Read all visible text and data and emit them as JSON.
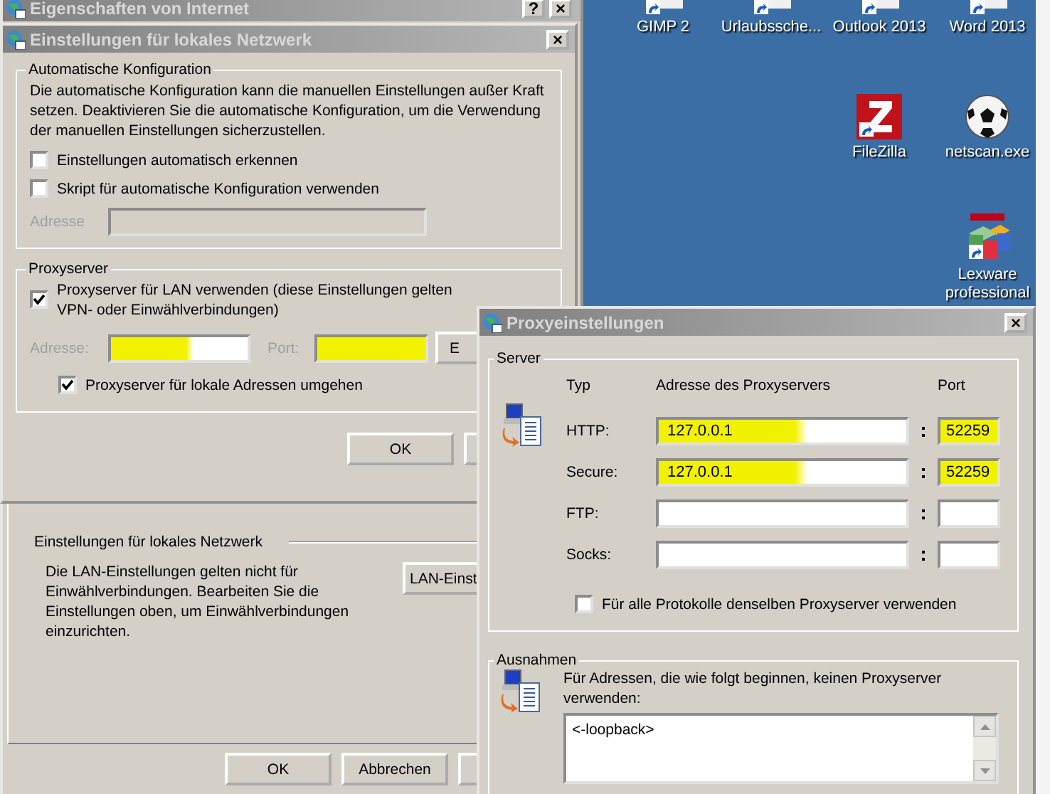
{
  "internet_options": {
    "title": "Eigenschaften von Internet",
    "help_button": "?",
    "close_button": "×",
    "lan_group": {
      "heading": "Einstellungen für lokales Netzwerk",
      "text": "Die LAN-Einstellungen gelten nicht für Einwählverbindungen. Bearbeiten Sie die Einstellungen oben, um Einwählverbindungen einzurichten.",
      "button": "LAN-Einst"
    },
    "buttons": [
      "OK",
      "Abbrechen"
    ]
  },
  "lan_dialog": {
    "title": "Einstellungen für lokales Netzwerk",
    "close_button": "×",
    "auto_config": {
      "legend": "Automatische Konfiguration",
      "text": "Die automatische Konfiguration kann die manuellen Einstellungen außer Kraft setzen. Deaktivieren Sie die automatische Konfiguration, um die Verwendung der manuellen Einstellungen sicherzustellen.",
      "options": [
        {
          "label": "Einstellungen automatisch erkennen",
          "checked": false
        },
        {
          "label": "Skript für automatische Konfiguration verwenden",
          "checked": false
        }
      ],
      "address": {
        "label": "Adresse",
        "disabled": true
      }
    },
    "proxy": {
      "legend": "Proxyserver",
      "use_proxy": {
        "lines": [
          "Proxyserver für LAN verwenden (diese Einstellungen gelten",
          "VPN- oder Einwählverbindungen)"
        ],
        "checked": true
      },
      "address": {
        "label": "Adresse:",
        "disabled": true,
        "highlighted": true
      },
      "port": {
        "label": "Port:",
        "disabled": true,
        "highlighted": true
      },
      "advanced_button": "E",
      "bypass": {
        "label": "Proxyserver für lokale Adressen umgehen",
        "checked": true
      }
    },
    "buttons": [
      "OK"
    ]
  },
  "proxy_dialog": {
    "title": "Proxyeinstellungen",
    "close_button": "×",
    "server": {
      "legend": "Server",
      "columns": [
        "Typ",
        "Adresse des Proxyservers",
        "Port"
      ],
      "rows": [
        {
          "type": "HTTP:",
          "address": "127.0.0.1",
          "port": "52259",
          "highlighted": true
        },
        {
          "type": "Secure:",
          "address": "127.0.0.1",
          "port": "52259",
          "highlighted": true
        },
        {
          "type": "FTP:",
          "highlighted": false
        },
        {
          "type": "Socks:",
          "highlighted": false
        }
      ],
      "same_proxy": {
        "label": "Für alle Protokolle denselben Proxyserver verwenden",
        "checked": false
      }
    },
    "exceptions": {
      "legend": "Ausnahmen",
      "text": "Für Adressen, die wie folgt beginnen, keinen Proxyserver verwenden:",
      "value": "<-loopback>"
    }
  },
  "desktop": {
    "icons": [
      {
        "label": "GIMP 2",
        "kind": "cut"
      },
      {
        "label": "Urlaubssche...",
        "kind": "cut"
      },
      {
        "label": "Outlook 2013",
        "kind": "cut"
      },
      {
        "label": "Word 2013",
        "kind": "cut"
      },
      {
        "label": "FileZilla",
        "kind": "filezilla"
      },
      {
        "label": "netscan.exe",
        "kind": "ball"
      },
      {
        "label": "Lexware professional",
        "kind": "lexware"
      }
    ]
  }
}
